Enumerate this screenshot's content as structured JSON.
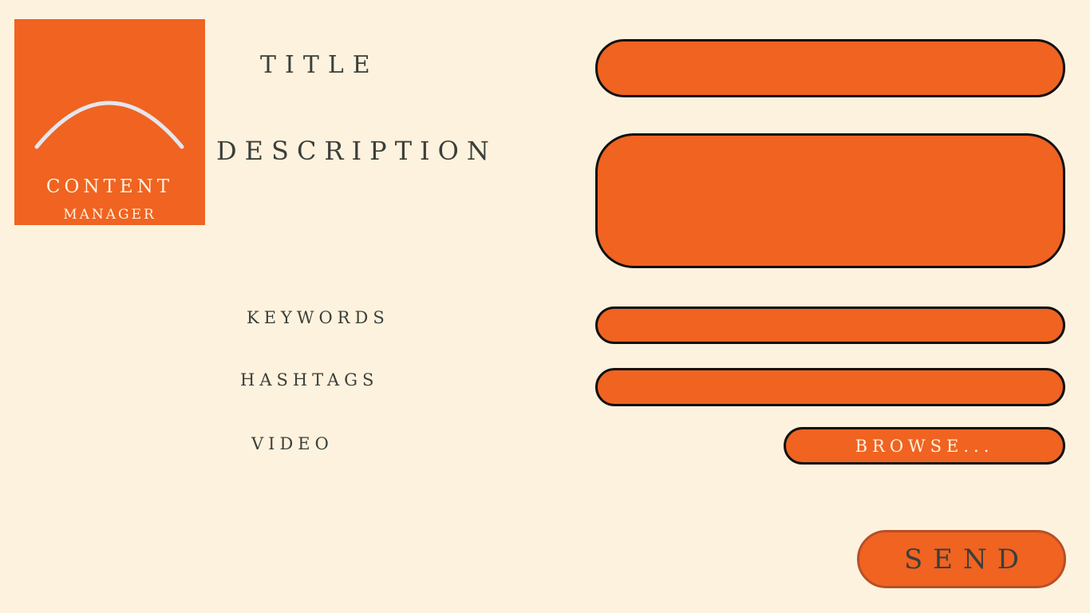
{
  "logo": {
    "line1": "CONTENT",
    "line2": "MANAGER"
  },
  "form": {
    "title_label": "TITLE",
    "description_label": "DESCRIPTION",
    "keywords_label": "KEYWORDS",
    "hashtags_label": "HASHTAGS",
    "video_label": "VIDEO",
    "title_value": "",
    "description_value": "",
    "keywords_value": "",
    "hashtags_value": ""
  },
  "actions": {
    "browse_label": "BROWSE...",
    "send_label": "SEND"
  },
  "colors": {
    "background": "#FDF2DE",
    "accent": "#F06321",
    "text": "#3B3F3A",
    "arc": "#E4E6EE",
    "field_border": "#111111",
    "send_border": "#B5502A"
  }
}
